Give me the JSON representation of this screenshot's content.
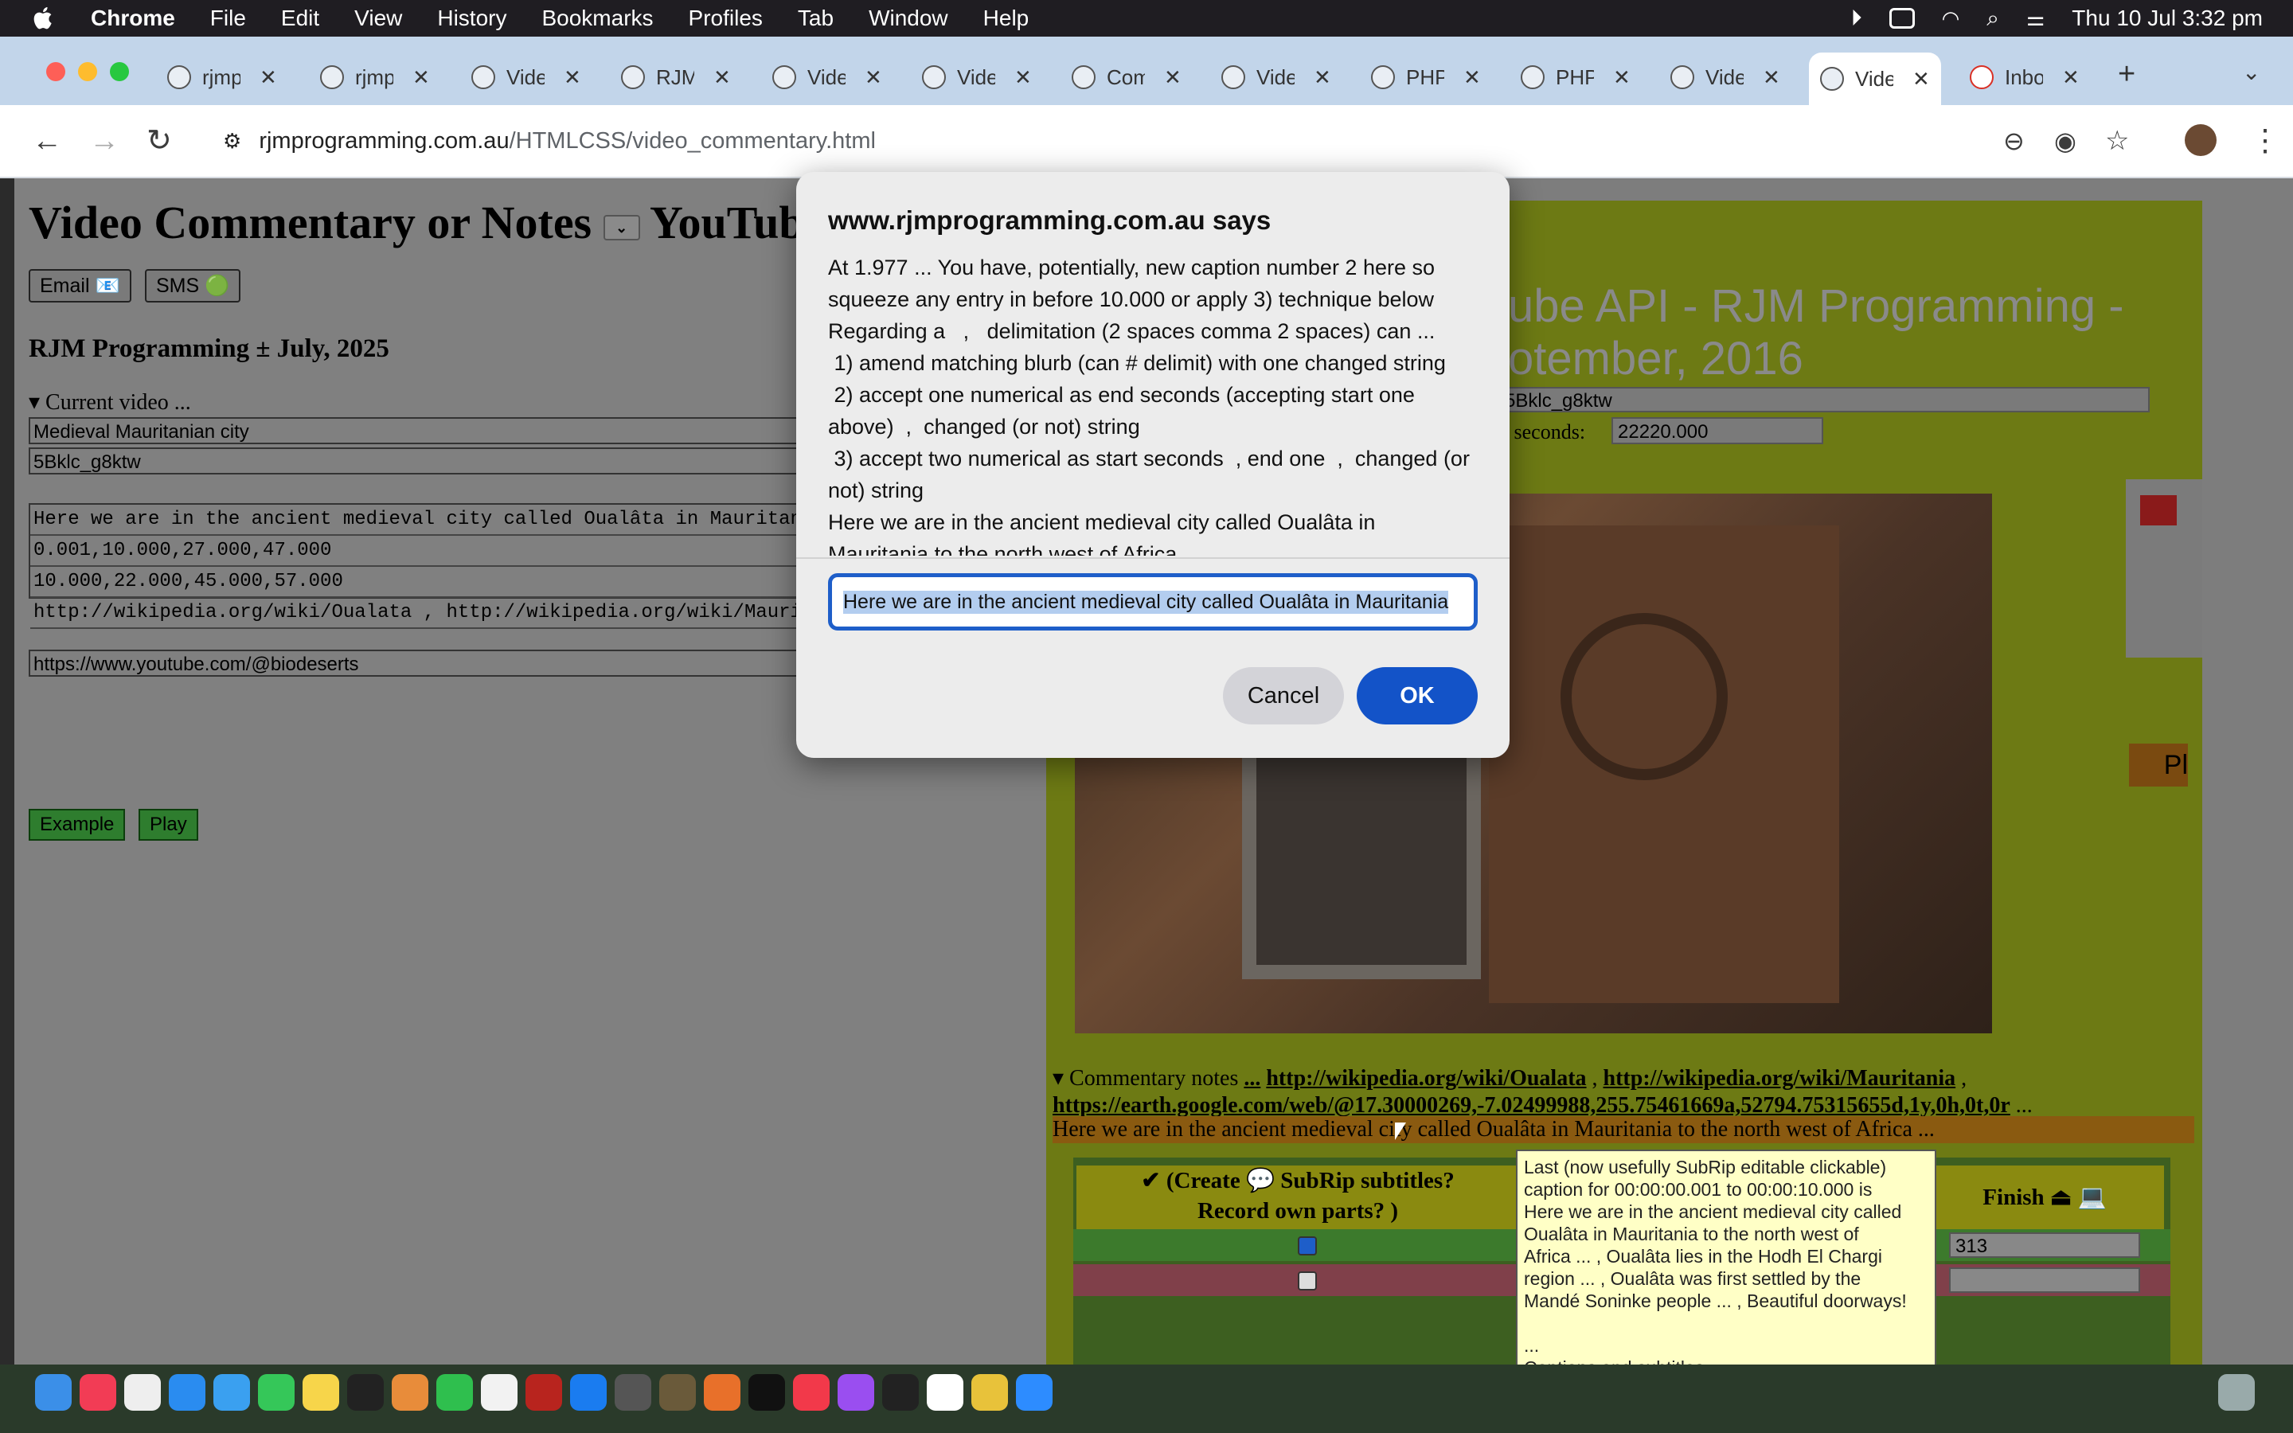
{
  "menubar": {
    "app": "Chrome",
    "items": [
      "File",
      "Edit",
      "View",
      "History",
      "Bookmarks",
      "Profiles",
      "Tab",
      "Window",
      "Help"
    ],
    "clock": "Thu 10 Jul  3:32 pm"
  },
  "tabs": [
    {
      "label": "rjmp"
    },
    {
      "label": "rjmp"
    },
    {
      "label": "Vide"
    },
    {
      "label": "RJM"
    },
    {
      "label": "Vide"
    },
    {
      "label": "Vide"
    },
    {
      "label": "Com"
    },
    {
      "label": "Vide"
    },
    {
      "label": "PHP"
    },
    {
      "label": "PHP"
    },
    {
      "label": "Vide"
    },
    {
      "label": "Vide"
    },
    {
      "label": "Inbo"
    }
  ],
  "tab_close": "✕",
  "new_tab": "+",
  "address": {
    "domain": "rjmprogramming.com.au",
    "path": "/HTMLCSS/video_commentary.html"
  },
  "page": {
    "title": "Video Commentary or Notes",
    "title_tail": "YouTub",
    "email_btn": "Email 📧",
    "sms_btn": "SMS 🟢",
    "subhead": "RJM Programming ± July, 2025",
    "current_video_summary": "▾ Current video ...",
    "video_title": "Medieval Mauritanian city",
    "video_id": "5Bklc_g8ktw",
    "ta_lines": [
      "Here we are in the ancient medieval city called Oualâta in Mauritan",
      "0.001,10.000,27.000,47.000",
      "10.000,22.000,45.000,57.000",
      "http://wikipedia.org/wiki/Oualata , http://wikipedia.org/wiki/Mauri"
    ],
    "channel_url": "https://www.youtube.com/@biodeserts",
    "example_btn": "Example",
    "play_btn": "Play"
  },
  "right": {
    "yt_title_line1": "ube API - RJM Programming -",
    "yt_title_line2": "otember, 2016",
    "yt_id": "5Bklc_g8ktw",
    "seconds_label": "n seconds:",
    "seconds_value": "22220.000",
    "side_label": "Pl",
    "commentary_summary": "▾ Commentary notes",
    "commentary_dots": "...",
    "link1": "http://wikipedia.org/wiki/Oualata",
    "link2": "http://wikipedia.org/wiki/Mauritania",
    "link3": "https://earth.google.com/web/@17.30000269,-7.02499988,255.75461669a,52794.75315655d,1y,0h,0t,0r",
    "link3_tail": "...",
    "caption_bar": "Here we are in the ancient medieval city called Oualâta in Mauritania to the north west of Africa ...",
    "table_head_left_1": "✔ (Create 💬 SubRip subtitles?",
    "table_head_left_2": "Record own parts?        )",
    "table_head_finish": "Finish ⏏ 💻",
    "finish_value": "313"
  },
  "tooltip": {
    "lines": [
      "Last (now usefully SubRip editable clickable)",
      "caption for 00:00:00.001 to 00:00:10.000 is",
      "Here we are in the ancient medieval city called",
      "Oualâta in Mauritania to the north west of",
      "Africa ...  ,  Oualâta lies in the Hodh El Chargi",
      "region ...  ,  Oualâta was first settled by the",
      "Mandé Soninke people ...  ,  Beautiful doorways!",
      "",
      " ...",
      "Captions and subtitles"
    ]
  },
  "dialog": {
    "title": "www.rjmprogramming.com.au says",
    "message": [
      "At 1.977 ... You have, potentially, new caption number 2 here so squeeze any entry in before 10.000 or apply 3) technique below",
      "Regarding a   ,   delimitation (2 spaces comma 2 spaces) can ...",
      " 1) amend matching blurb (can # delimit) with one changed string",
      " 2) accept one numerical as end seconds (accepting start one above)  ,  changed (or not) string",
      " 3) accept two numerical as start seconds  , end one  ,  changed (or not) string",
      "Here we are in the ancient medieval city called Oualâta in Mauritania to the north west of Africa"
    ],
    "input_value": "Here we are in the ancient medieval city called Oualâta in Mauritania",
    "cancel": "Cancel",
    "ok": "OK"
  },
  "colors": {
    "dialog_ok": "#1353c8",
    "input_focus": "#1e5ec9",
    "page_dim": "#808080"
  }
}
